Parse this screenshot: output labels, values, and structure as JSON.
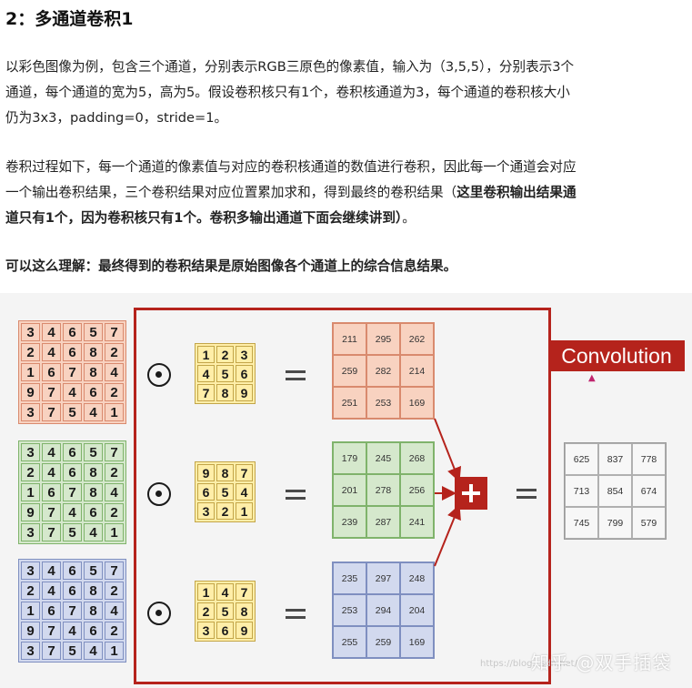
{
  "heading": "2：多通道卷积1",
  "paragraphs": {
    "p1_line1": "以彩色图像为例，包含三个通道，分别表示RGB三原色的像素值，输入为（3,5,5），分别表示3个",
    "p1_line2": "通道，每个通道的宽为5，高为5。假设卷积核只有1个，卷积核通道为3，每个通道的卷积核大小",
    "p1_line3": "仍为3x3，padding=0，stride=1。",
    "p2_line1": "卷积过程如下，每一个通道的像素值与对应的卷积核通道的数值进行卷积，因此每一个通道会对应",
    "p2_line2_pre": "一个输出卷积结果，三个卷积结果对应位置累加求和，得到最终的卷积结果（",
    "p2_line2_bold": "这里卷积输出结果通",
    "p2_line3_bold": "道只有1个，因为卷积核只有1个。卷积多输出通道下面会继续讲到）",
    "p2_line3_end": "。",
    "p3": "可以这么理解：最终得到的卷积结果是原始图像各个通道上的综合信息结果。"
  },
  "figure": {
    "conv_label": "Convolution",
    "input_red": [
      [
        3,
        4,
        6,
        5,
        7
      ],
      [
        2,
        4,
        6,
        8,
        2
      ],
      [
        1,
        6,
        7,
        8,
        4
      ],
      [
        9,
        7,
        4,
        6,
        2
      ],
      [
        3,
        7,
        5,
        4,
        1
      ]
    ],
    "input_green": [
      [
        3,
        4,
        6,
        5,
        7
      ],
      [
        2,
        4,
        6,
        8,
        2
      ],
      [
        1,
        6,
        7,
        8,
        4
      ],
      [
        9,
        7,
        4,
        6,
        2
      ],
      [
        3,
        7,
        5,
        4,
        1
      ]
    ],
    "input_blue": [
      [
        3,
        4,
        6,
        5,
        7
      ],
      [
        2,
        4,
        6,
        8,
        2
      ],
      [
        1,
        6,
        7,
        8,
        4
      ],
      [
        9,
        7,
        4,
        6,
        2
      ],
      [
        3,
        7,
        5,
        4,
        1
      ]
    ],
    "kernel_red": [
      [
        1,
        2,
        3
      ],
      [
        4,
        5,
        6
      ],
      [
        7,
        8,
        9
      ]
    ],
    "kernel_green": [
      [
        9,
        8,
        7
      ],
      [
        6,
        5,
        4
      ],
      [
        3,
        2,
        1
      ]
    ],
    "kernel_blue": [
      [
        1,
        4,
        7
      ],
      [
        2,
        5,
        8
      ],
      [
        3,
        6,
        9
      ]
    ],
    "result_red": [
      [
        211,
        295,
        262
      ],
      [
        259,
        282,
        214
      ],
      [
        251,
        253,
        169
      ]
    ],
    "result_green": [
      [
        179,
        245,
        268
      ],
      [
        201,
        278,
        256
      ],
      [
        239,
        287,
        241
      ]
    ],
    "result_blue": [
      [
        235,
        297,
        248
      ],
      [
        253,
        294,
        204
      ],
      [
        255,
        259,
        169
      ]
    ],
    "final": [
      [
        625,
        837,
        778
      ],
      [
        713,
        854,
        674
      ],
      [
        745,
        799,
        579
      ]
    ],
    "watermark_url": "https://blog.csdn.net/",
    "brand": "知乎 @双手插袋"
  },
  "colors": {
    "red_fill": "#f8d2c0",
    "green_fill": "#d5e8cc",
    "blue_fill": "#d2d9ee",
    "kernel_fill": "#ffeea8",
    "accent": "#b5231c"
  }
}
